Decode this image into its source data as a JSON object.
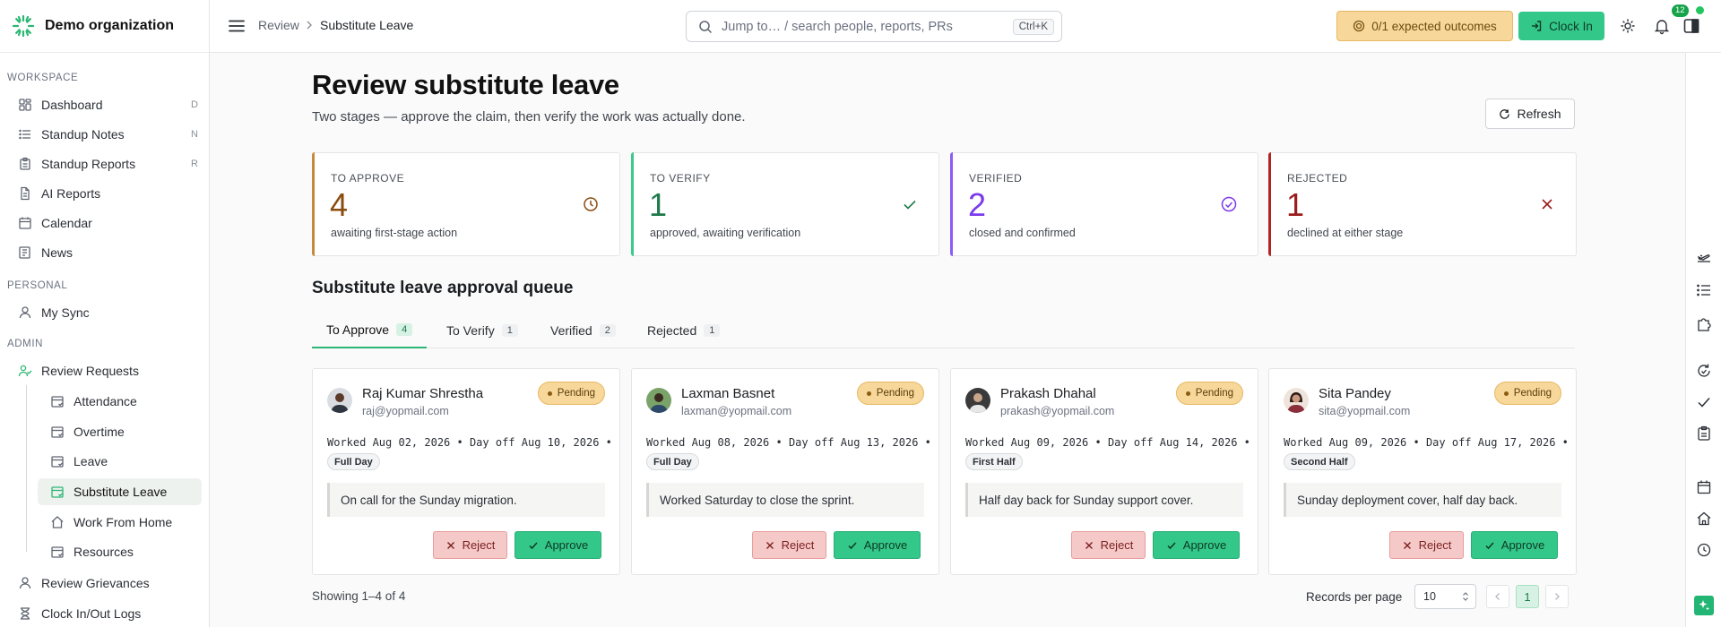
{
  "org": {
    "name": "Demo organization"
  },
  "sidebar": {
    "workspace_label": "WORKSPACE",
    "workspace_items": [
      {
        "label": "Dashboard",
        "shortcut": "D",
        "icon": "dashboard-icon"
      },
      {
        "label": "Standup Notes",
        "shortcut": "N",
        "icon": "list-icon"
      },
      {
        "label": "Standup Reports",
        "shortcut": "R",
        "icon": "clipboard-icon"
      },
      {
        "label": "AI Reports",
        "shortcut": "",
        "icon": "document-icon"
      },
      {
        "label": "Calendar",
        "shortcut": "",
        "icon": "calendar-icon"
      },
      {
        "label": "News",
        "shortcut": "",
        "icon": "news-icon"
      }
    ],
    "personal_label": "PERSONAL",
    "personal_items": [
      {
        "label": "My Sync",
        "icon": "user-icon"
      }
    ],
    "admin_label": "ADMIN",
    "admin_items": [
      {
        "label": "Review Requests",
        "icon": "users-icon"
      },
      {
        "label": "Review Grievances",
        "icon": "user-icon"
      },
      {
        "label": "Clock In/Out Logs",
        "icon": "hourglass-icon"
      }
    ],
    "review_sub_items": [
      {
        "label": "Attendance",
        "icon": "calendar-check-icon",
        "active": false
      },
      {
        "label": "Overtime",
        "icon": "calendar-check-icon",
        "active": false
      },
      {
        "label": "Leave",
        "icon": "calendar-check-icon",
        "active": false
      },
      {
        "label": "Substitute Leave",
        "icon": "calendar-check-icon",
        "active": true
      },
      {
        "label": "Work From Home",
        "icon": "home-icon",
        "active": false
      },
      {
        "label": "Resources",
        "icon": "calendar-check-icon",
        "active": false
      }
    ]
  },
  "header": {
    "breadcrumb": [
      "Review",
      "Substitute Leave"
    ],
    "search_placeholder": "Jump to… / search people, reports, PRs",
    "search_shortcut": "Ctrl+K",
    "outcomes_label": "0/1 expected outcomes",
    "clockin_label": "Clock In",
    "notification_count": "12"
  },
  "page": {
    "title": "Review substitute leave",
    "subtitle": "Two stages — approve the claim, then verify the work was actually done.",
    "refresh_label": "Refresh"
  },
  "stats": [
    {
      "label": "TO APPROVE",
      "value": "4",
      "desc": "awaiting first-stage action",
      "color": "#8a4b0f",
      "icon": "clock-icon"
    },
    {
      "label": "TO VERIFY",
      "value": "1",
      "desc": "approved, awaiting verification",
      "color": "#1f7a4a",
      "icon": "check-icon"
    },
    {
      "label": "VERIFIED",
      "value": "2",
      "desc": "closed and confirmed",
      "color": "#7c3aed",
      "icon": "check-circle-icon"
    },
    {
      "label": "REJECTED",
      "value": "1",
      "desc": "declined at either stage",
      "color": "#9b1c1c",
      "icon": "x-icon"
    }
  ],
  "queue": {
    "title": "Substitute leave approval queue",
    "tabs": [
      {
        "label": "To Approve",
        "count": "4",
        "active": true
      },
      {
        "label": "To Verify",
        "count": "1",
        "active": false
      },
      {
        "label": "Verified",
        "count": "2",
        "active": false
      },
      {
        "label": "Rejected",
        "count": "1",
        "active": false
      }
    ],
    "cards": [
      {
        "name": "Raj Kumar Shrestha",
        "email": "raj@yopmail.com",
        "status": "Pending",
        "dates": "Worked Aug 02, 2026 • Day off Aug 10, 2026 •",
        "day_type": "Full Day",
        "note": "On call for the Sunday migration.",
        "reject": "Reject",
        "approve": "Approve"
      },
      {
        "name": "Laxman Basnet",
        "email": "laxman@yopmail.com",
        "status": "Pending",
        "dates": "Worked Aug 08, 2026 • Day off Aug 13, 2026 •",
        "day_type": "Full Day",
        "note": "Worked Saturday to close the sprint.",
        "reject": "Reject",
        "approve": "Approve"
      },
      {
        "name": "Prakash Dhahal",
        "email": "prakash@yopmail.com",
        "status": "Pending",
        "dates": "Worked Aug 09, 2026 • Day off Aug 14, 2026 •",
        "day_type": "First Half",
        "note": "Half day back for Sunday support cover.",
        "reject": "Reject",
        "approve": "Approve"
      },
      {
        "name": "Sita Pandey",
        "email": "sita@yopmail.com",
        "status": "Pending",
        "dates": "Worked Aug 09, 2026 • Day off Aug 17, 2026 •",
        "day_type": "Second Half",
        "note": "Sunday deployment cover, half day back.",
        "reject": "Reject",
        "approve": "Approve"
      }
    ]
  },
  "footer": {
    "showing": "Showing 1–4 of 4",
    "rpp_label": "Records per page",
    "rpp_value": "10",
    "current_page": "1"
  }
}
